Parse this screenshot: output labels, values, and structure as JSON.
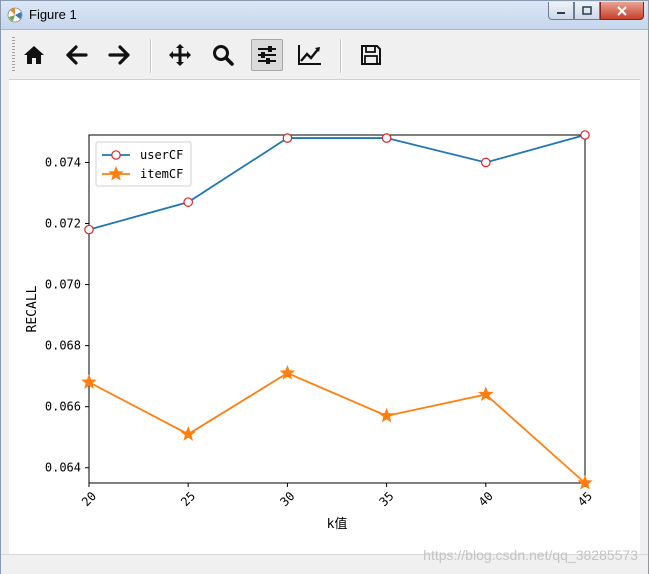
{
  "window": {
    "title": "Figure 1",
    "controls": [
      "minimize",
      "maximize",
      "close"
    ]
  },
  "toolbar": {
    "buttons": [
      {
        "name": "home",
        "icon": "home-icon"
      },
      {
        "name": "back",
        "icon": "arrow-left-icon"
      },
      {
        "name": "forward",
        "icon": "arrow-right-icon"
      },
      {
        "name": "pan",
        "icon": "move-icon"
      },
      {
        "name": "zoom",
        "icon": "magnifier-icon"
      },
      {
        "name": "subplots",
        "icon": "sliders-icon",
        "active": true
      },
      {
        "name": "edit-axis",
        "icon": "line-chart-icon"
      },
      {
        "name": "save",
        "icon": "floppy-disk-icon"
      }
    ]
  },
  "chart_data": {
    "type": "line",
    "x": [
      20,
      25,
      30,
      35,
      40,
      45
    ],
    "series": [
      {
        "name": "userCF",
        "marker": "open-circle",
        "color": "#1f77b4",
        "marker_edge": "#d62728",
        "values": [
          0.0718,
          0.0727,
          0.0748,
          0.0748,
          0.074,
          0.0749
        ]
      },
      {
        "name": "itemCF",
        "marker": "star",
        "color": "#ff7f0e",
        "values": [
          0.0668,
          0.0651,
          0.0671,
          0.0657,
          0.0664,
          0.0635
        ]
      }
    ],
    "xlabel": "k值",
    "ylabel": "RECALL",
    "xlim": [
      20,
      45
    ],
    "ylim": [
      0.0635,
      0.0749
    ],
    "yticks": [
      "0.064",
      "0.066",
      "0.068",
      "0.070",
      "0.072",
      "0.074"
    ],
    "xticks": [
      "20",
      "25",
      "30",
      "35",
      "40",
      "45"
    ],
    "xtick_rotation": 45,
    "legend_position": "upper-left",
    "grid": false
  },
  "watermark": "https://blog.csdn.net/qq_38285573"
}
